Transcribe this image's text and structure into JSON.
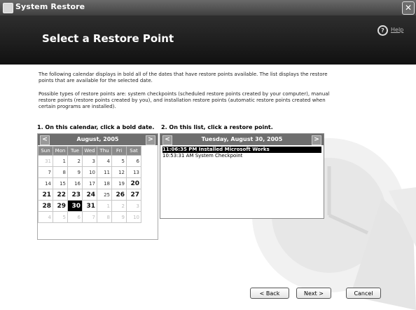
{
  "window": {
    "title": "System Restore",
    "close_glyph": "✕"
  },
  "header": {
    "heading": "Select a Restore Point",
    "help_label": "Help",
    "help_icon_glyph": "?"
  },
  "description": [
    "The following calendar displays in bold all of the dates that have restore points available. The list displays the restore points that are available for the selected date.",
    "Possible types of restore points are: system checkpoints (scheduled restore points created by your computer), manual restore points (restore points created by you), and installation restore points (automatic restore points created when certain programs are installed)."
  ],
  "calendar": {
    "label": "1. On this calendar, click a bold date.",
    "month": "August, 2005",
    "prev_glyph": "<",
    "next_glyph": ">",
    "weekdays": [
      "Sun",
      "Mon",
      "Tue",
      "Wed",
      "Thu",
      "Fri",
      "Sat"
    ],
    "weeks": [
      [
        "31",
        "1",
        "2",
        "3",
        "4",
        "5",
        "6"
      ],
      [
        "7",
        "8",
        "9",
        "10",
        "11",
        "12",
        "13"
      ],
      [
        "14",
        "15",
        "16",
        "17",
        "18",
        "19",
        "20"
      ],
      [
        "21",
        "22",
        "23",
        "24",
        "25",
        "26",
        "27"
      ],
      [
        "28",
        "29",
        "30",
        "31",
        "1",
        "2",
        "3"
      ],
      [
        "4",
        "5",
        "6",
        "7",
        "8",
        "9",
        "10"
      ]
    ]
  },
  "restore_list": {
    "label": "2. On this list, click a restore point.",
    "date": "Tuesday, August 30, 2005",
    "prev_glyph": "<",
    "next_glyph": ">",
    "items": [
      {
        "text": "11:06:35 PM  Installed Microsoft Works",
        "selected": true
      },
      {
        "text": "10:53:31 AM  System Checkpoint",
        "selected": false
      }
    ]
  },
  "buttons": {
    "back": "< Back",
    "next": "Next >",
    "cancel": "Cancel"
  }
}
